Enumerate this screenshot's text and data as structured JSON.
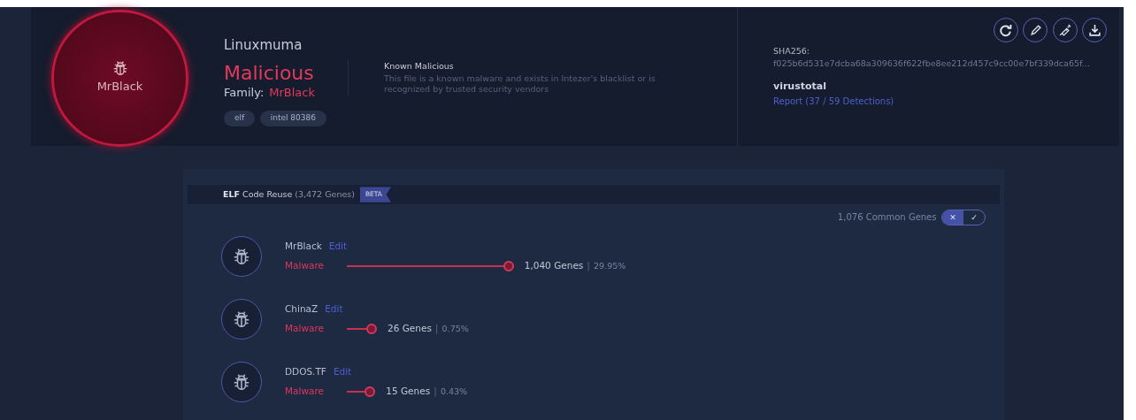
{
  "verdict_circle": {
    "family": "MrBlack"
  },
  "header": {
    "file_name": "Linuxmuma",
    "verdict": "Malicious",
    "family_label": "Family:",
    "family": "MrBlack",
    "tags": [
      "elf",
      "intel 80386"
    ],
    "verdict_title": "Known Malicious",
    "verdict_description": "This file is a known malware and exists in Intezer's blacklist or is recognized by trusted security vendors"
  },
  "actions": [
    {
      "kind": "refresh"
    },
    {
      "kind": "edit"
    },
    {
      "kind": "inject"
    },
    {
      "kind": "download"
    }
  ],
  "hash": {
    "label": "SHA256:",
    "value": "f025b6d531e7dcba68a309636f622fbe8ee212d457c9cc00e7bf339dca65f..."
  },
  "virustotal": {
    "title": "virustotal",
    "link": "Report (37 / 59 Detections)"
  },
  "code_reuse": {
    "title_bold": "ELF",
    "title": "Code Reuse",
    "count": "(3,472 Genes)",
    "badge": "BETA",
    "common_genes": "1,076 Common Genes",
    "toggle": [
      {
        "symbol": "✕",
        "selected": true
      },
      {
        "symbol": "✓",
        "selected": false
      }
    ],
    "families": [
      {
        "name": "MrBlack",
        "edit": "Edit",
        "type": "Malware",
        "genes": "1,040 Genes",
        "separator": "|",
        "percent": "29.95%"
      },
      {
        "name": "ChinaZ",
        "edit": "Edit",
        "type": "Malware",
        "genes": "26 Genes",
        "separator": "|",
        "percent": "0.75%"
      },
      {
        "name": "DDOS.TF",
        "edit": "Edit",
        "type": "Malware",
        "genes": "15 Genes",
        "separator": "|",
        "percent": "0.43%"
      }
    ]
  }
}
